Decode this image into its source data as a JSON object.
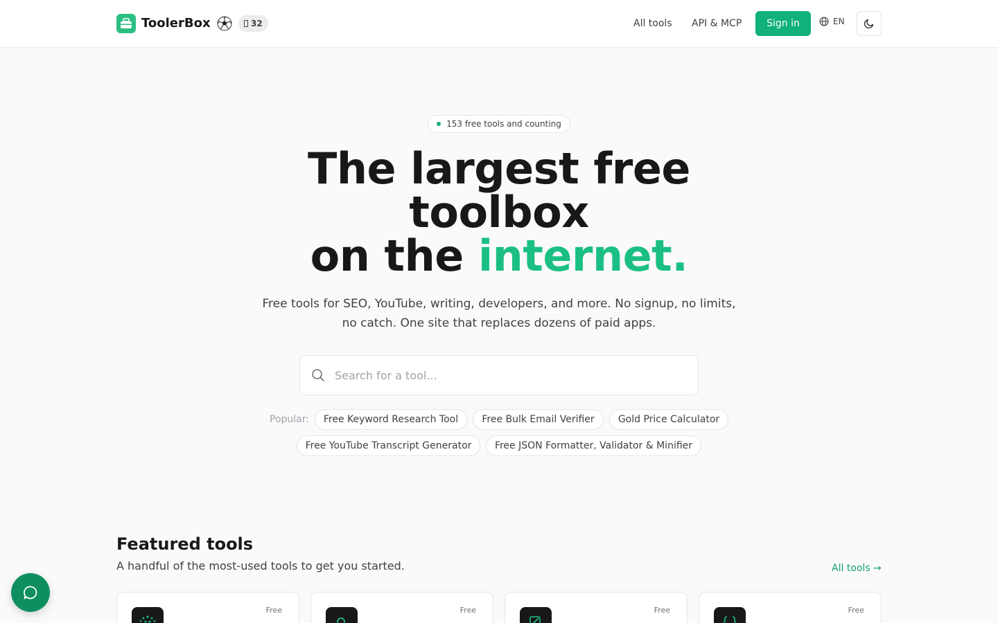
{
  "colors": {
    "brand": "#10b17a",
    "accent_text": "#1bbf84",
    "link": "#10a371",
    "chat_button": "#0f8f60"
  },
  "header": {
    "brand": "ToolerBox",
    "count_badge": "32",
    "nav": [
      "All tools",
      "API & MCP"
    ],
    "sign_in": "Sign in",
    "language": "EN"
  },
  "hero": {
    "pill": "153 free tools and counting",
    "title_line1": "The largest free toolbox",
    "title_line2_prefix": "on the ",
    "title_line2_accent": "internet.",
    "subtitle": "Free tools for SEO, YouTube, writing, developers, and more. No signup, no limits, no catch. One site that replaces dozens of paid apps.",
    "search_placeholder": "Search for a tool...",
    "popular_label": "Popular:",
    "popular": [
      "Free Keyword Research Tool",
      "Free Bulk Email Verifier",
      "Gold Price Calculator",
      "Free YouTube Transcript Generator",
      "Free JSON Formatter, Validator & Minifier"
    ]
  },
  "featured": {
    "title": "Featured tools",
    "subtitle": "A handful of the most-used tools to get you started.",
    "all_tools_link": "All tools →",
    "cards": [
      {
        "badge": "Free",
        "icon": "sparkle-icon"
      },
      {
        "badge": "Free",
        "icon": "search-icon"
      },
      {
        "badge": "Free",
        "icon": "edit-icon"
      },
      {
        "badge": "Free",
        "icon": "braces-icon"
      }
    ]
  }
}
